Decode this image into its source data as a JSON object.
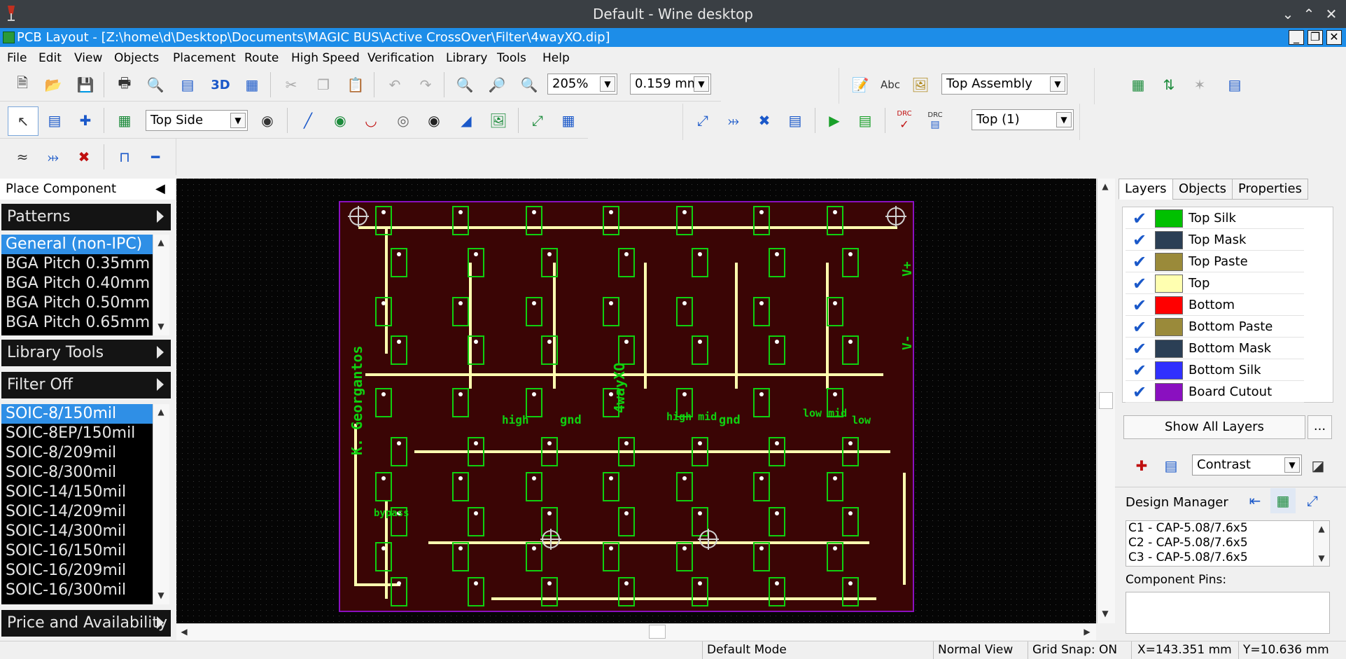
{
  "wine": {
    "title": "Default - Wine desktop"
  },
  "app": {
    "title": "PCB Layout - [Z:\\home\\d\\Desktop\\Documents\\MAGIC BUS\\Active CrossOver\\Filter\\4wayXO.dip]"
  },
  "menu": [
    "File",
    "Edit",
    "View",
    "Objects",
    "Placement",
    "Route",
    "High Speed",
    "Verification",
    "Library",
    "Tools",
    "Help"
  ],
  "toolbar": {
    "three_d": "3D",
    "zoom": "205%",
    "grid": "0.159 mm",
    "abc": "Abc",
    "assembly": "Top Assembly",
    "side": "Top Side",
    "drc1": "DRC",
    "drc2": "DRC",
    "layer_select": "Top (1)"
  },
  "left": {
    "place_component": "Place Component",
    "patterns": "Patterns",
    "pattern_list": [
      "General (non-IPC)",
      "BGA Pitch 0.35mm",
      "BGA Pitch 0.40mm",
      "BGA Pitch 0.50mm",
      "BGA Pitch 0.65mm"
    ],
    "library_tools": "Library Tools",
    "filter": "Filter Off",
    "package_list": [
      "SOIC-8/150mil",
      "SOIC-8EP/150mil",
      "SOIC-8/209mil",
      "SOIC-8/300mil",
      "SOIC-14/150mil",
      "SOIC-14/209mil",
      "SOIC-14/300mil",
      "SOIC-16/150mil",
      "SOIC-16/209mil",
      "SOIC-16/300mil"
    ],
    "price": "Price and Availability"
  },
  "board": {
    "texts": [
      "K. Georgantos",
      "4wayXO",
      "high",
      "gnd",
      "high mid",
      "gnd",
      "low mid",
      "low",
      "bypass",
      "V+",
      "V-"
    ]
  },
  "right": {
    "tabs": [
      "Layers",
      "Objects",
      "Properties"
    ],
    "layers": [
      {
        "name": "Top Silk",
        "color": "#00c000"
      },
      {
        "name": "Top Mask",
        "color": "#2b3f55"
      },
      {
        "name": "Top Paste",
        "color": "#9a8a3a"
      },
      {
        "name": "Top",
        "color": "#ffffb0"
      },
      {
        "name": "Bottom",
        "color": "#ff0000"
      },
      {
        "name": "Bottom Paste",
        "color": "#9a8a3a"
      },
      {
        "name": "Bottom Mask",
        "color": "#2b3f55"
      },
      {
        "name": "Bottom Silk",
        "color": "#3030ff"
      },
      {
        "name": "Board Cutout",
        "color": "#8a10c0"
      }
    ],
    "show_all": "Show All Layers",
    "more": "...",
    "contrast": "Contrast",
    "design_manager": "Design Manager",
    "components": [
      "C1 - CAP-5.08/7.6x5",
      "C2 - CAP-5.08/7.6x5",
      "C3 - CAP-5.08/7.6x5"
    ],
    "component_pins": "Component Pins:"
  },
  "status": {
    "mode": "Default Mode",
    "view": "Normal View",
    "grid_snap": "Grid Snap: ON",
    "x": "X=143.351 mm",
    "y": "Y=10.636 mm"
  }
}
